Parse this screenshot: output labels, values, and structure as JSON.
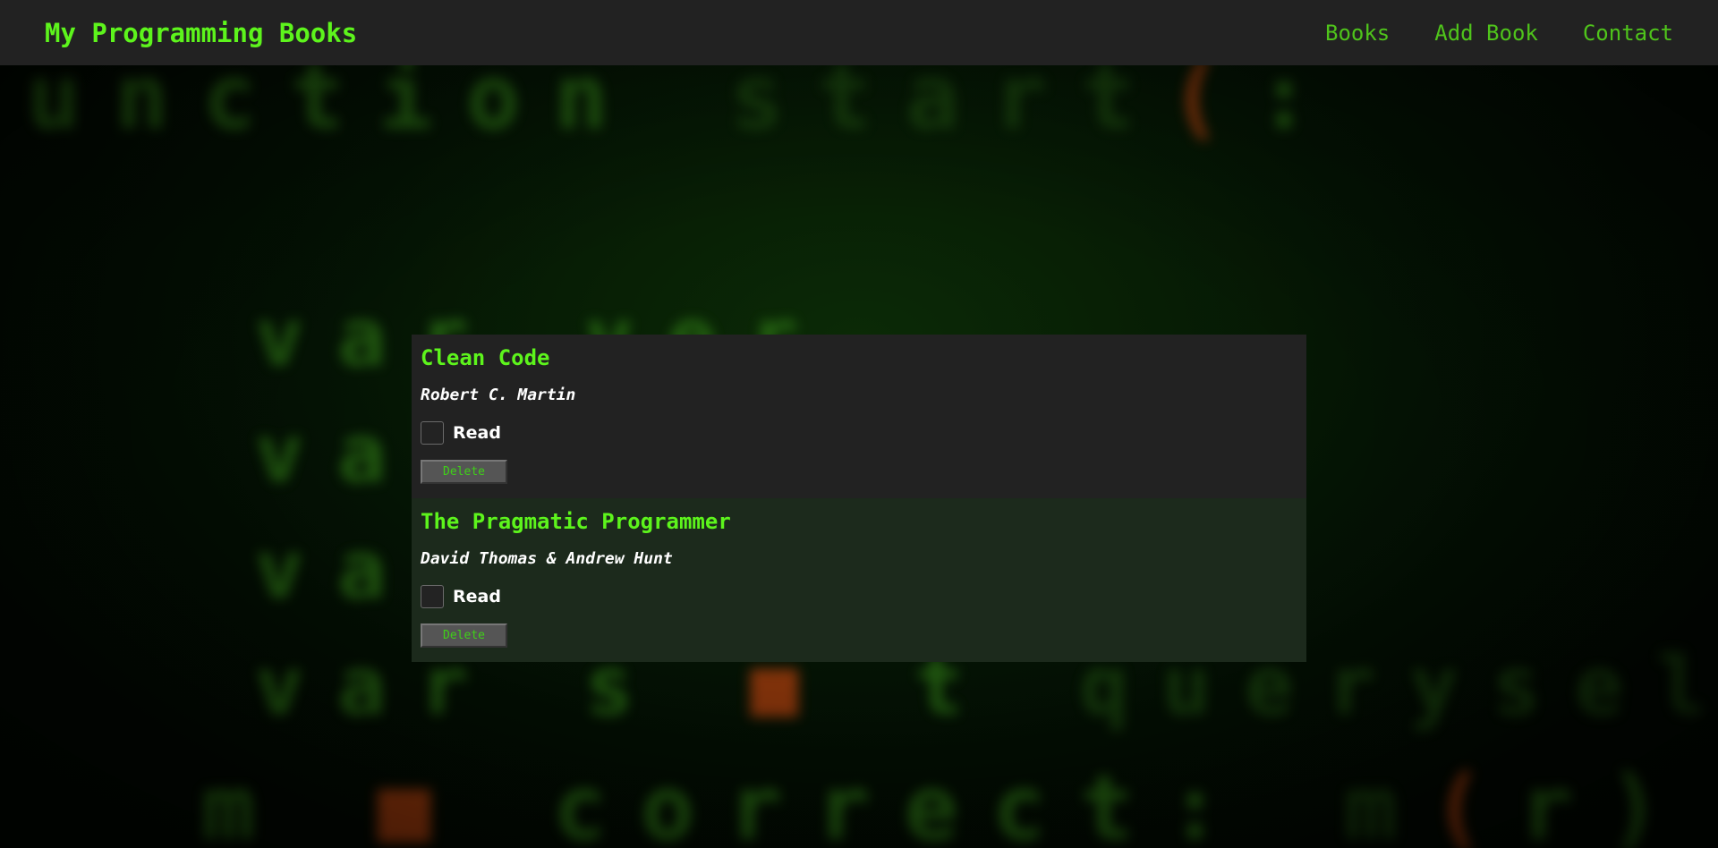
{
  "header": {
    "brand": "My Programming Books",
    "nav": [
      "Books",
      "Add Book",
      "Contact"
    ]
  },
  "books": [
    {
      "title": "Clean Code",
      "author": "Robert C. Martin",
      "read_label": "Read",
      "read": false,
      "delete_label": "Delete"
    },
    {
      "title": "The Pragmatic Programmer",
      "author": "David Thomas & Andrew Hunt",
      "read_label": "Read",
      "read": false,
      "delete_label": "Delete"
    }
  ],
  "colors": {
    "accent": "#5df41c",
    "nav_link": "#4fc41b",
    "header_bg": "#222222",
    "card_bg": "#222222",
    "card_alt_bg": "#1c2a1c",
    "button_bg": "#555555"
  }
}
